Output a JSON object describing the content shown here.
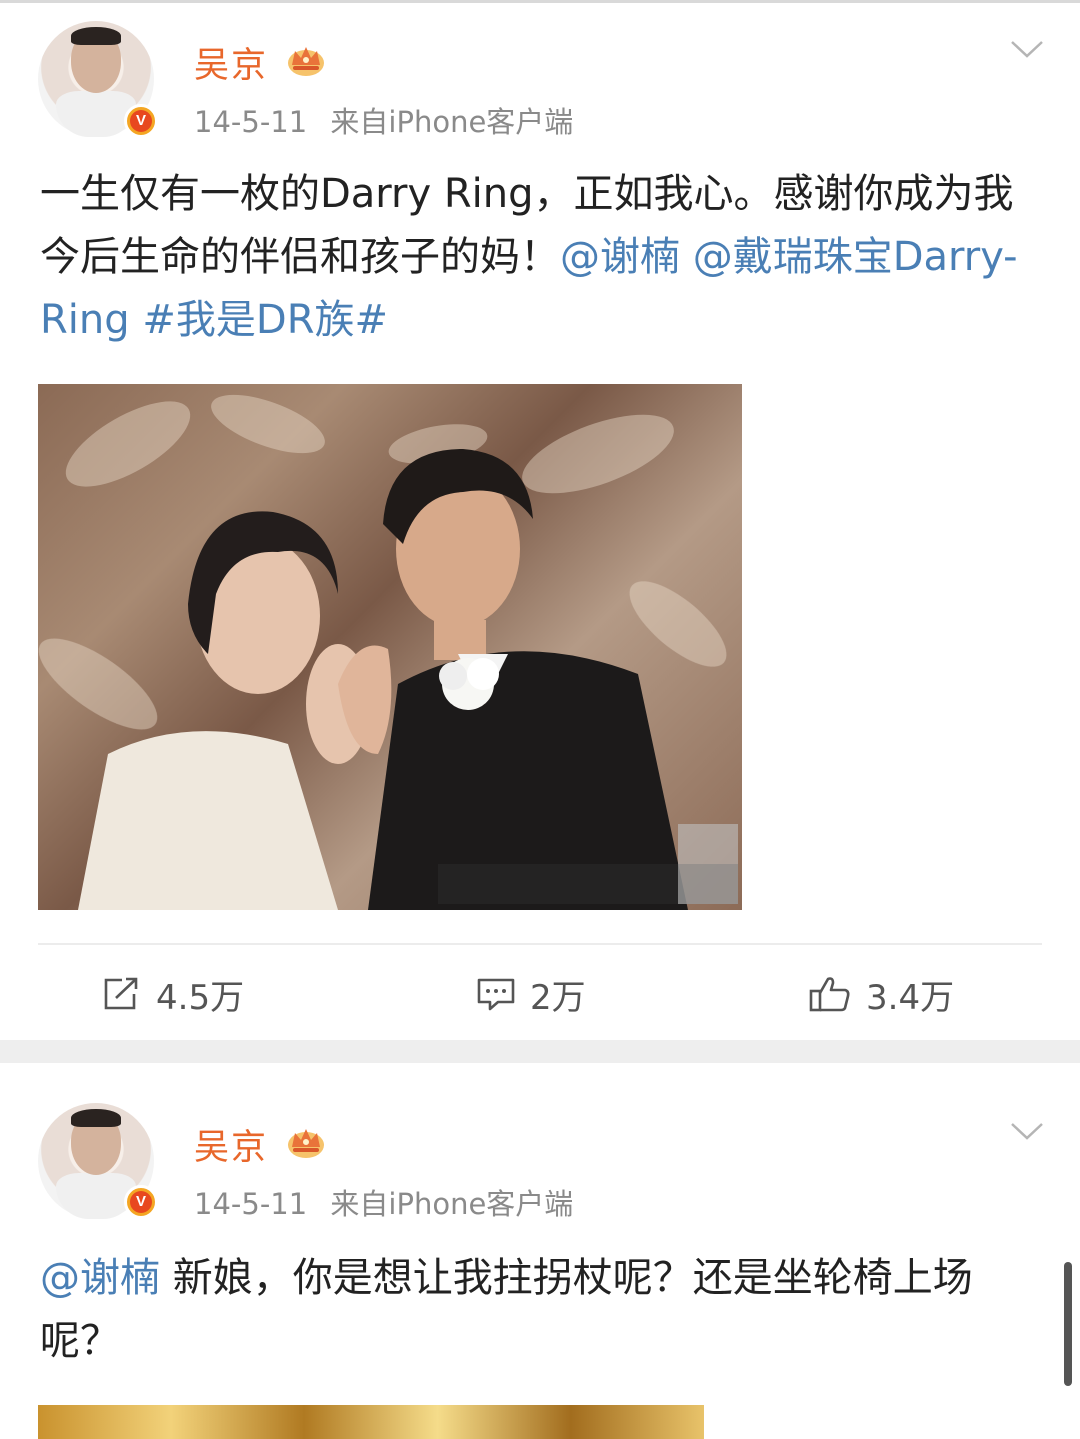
{
  "posts": [
    {
      "author": "吴京",
      "date": "14-5-11",
      "source": "来自iPhone客户端",
      "verified_mark": "V",
      "text_parts": {
        "p1": "一生仅有一枚的Darry Ring，正如我心。感谢你成为我今后生命的伴侣和孩子的妈！",
        "mention1": "@谢楠",
        "sep1": " ",
        "mention2": "@戴瑞珠宝Darry-Ring",
        "sep2": " ",
        "hashtag": "#我是DR族#"
      },
      "actions": {
        "repost_count": "4.5万",
        "comment_count": "2万",
        "like_count": "3.4万"
      }
    },
    {
      "author": "吴京",
      "date": "14-5-11",
      "source": "来自iPhone客户端",
      "verified_mark": "V",
      "text_parts": {
        "mention1": "@谢楠",
        "p1": " 新娘，你是想让我拄拐杖呢？还是坐轮椅上场呢？"
      }
    }
  ],
  "colors": {
    "username": "#e8672b",
    "link": "#4a7fb5",
    "meta": "#8a8a8a",
    "separator": "#eeeeee"
  },
  "icons": [
    "verified-v-icon",
    "crown-icon",
    "chevron-down-icon",
    "repost-icon",
    "comment-icon",
    "like-icon"
  ]
}
